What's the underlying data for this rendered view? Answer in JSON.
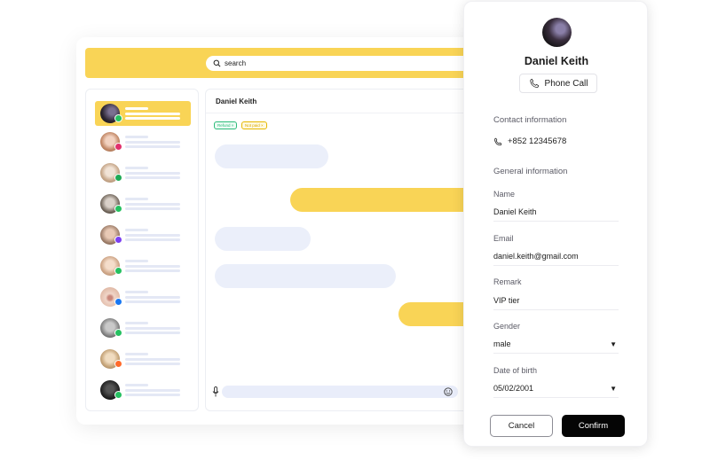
{
  "colors": {
    "accent": "#f9d456",
    "bubble_in": "#ebeffa",
    "primary_button": "#050505"
  },
  "search": {
    "placeholder": "search"
  },
  "sidebar": {
    "contacts": [
      {
        "channel": "whatsapp",
        "active": true
      },
      {
        "channel": "instagram"
      },
      {
        "channel": "whatsapp-business"
      },
      {
        "channel": "whatsapp"
      },
      {
        "channel": "messenger"
      },
      {
        "channel": "whatsapp"
      },
      {
        "channel": "facebook"
      },
      {
        "channel": "whatsapp"
      },
      {
        "channel": "other"
      },
      {
        "channel": "whatsapp"
      }
    ]
  },
  "chat": {
    "title": "Daniel Keith",
    "tags": [
      "Refund ×",
      "Not paid ×"
    ]
  },
  "profile": {
    "name": "Daniel Keith",
    "phone_call_label": "Phone Call",
    "contact_section": "Contact information",
    "phone": "+852 12345678",
    "general_section": "General information",
    "fields": {
      "name": {
        "label": "Name",
        "value": "Daniel Keith"
      },
      "email": {
        "label": "Email",
        "value": "daniel.keith@gmail.com"
      },
      "remark": {
        "label": "Remark",
        "value": "VIP tier"
      },
      "gender": {
        "label": "Gender",
        "value": "male"
      },
      "dob": {
        "label": "Date of birth",
        "value": "05/02/2001"
      }
    },
    "cancel_label": "Cancel",
    "confirm_label": "Confirm"
  }
}
